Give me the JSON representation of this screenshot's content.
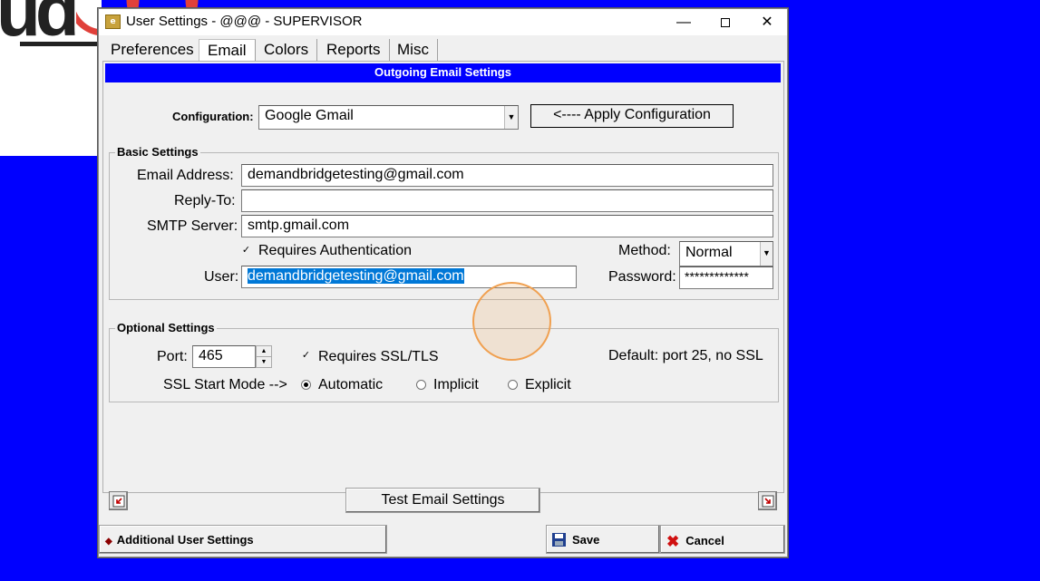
{
  "window": {
    "title": "User Settings - @@@ - SUPERVISOR",
    "app_icon_text": "e"
  },
  "tabs": [
    {
      "label": "Preferences",
      "active": false
    },
    {
      "label": "Email",
      "active": true
    },
    {
      "label": "Colors",
      "active": false
    },
    {
      "label": "Reports",
      "active": false
    },
    {
      "label": "Misc",
      "active": false
    }
  ],
  "header": {
    "title": "Outgoing Email Settings"
  },
  "configuration": {
    "label": "Configuration:",
    "value": "Google Gmail",
    "apply_label": "<---- Apply Configuration"
  },
  "basic": {
    "title": "Basic Settings",
    "email_label": "Email Address:",
    "email_value": "demandbridgetesting@gmail.com",
    "reply_label": "Reply-To:",
    "reply_value": "",
    "smtp_label": "SMTP Server:",
    "smtp_value": "smtp.gmail.com",
    "requires_auth_label": "Requires Authentication",
    "requires_auth_checked": true,
    "method_label": "Method:",
    "method_value": "Normal",
    "user_label": "User:",
    "user_value": "demandbridgetesting@gmail.com",
    "password_label": "Password:",
    "password_value": "*************"
  },
  "optional": {
    "title": "Optional Settings",
    "port_label": "Port:",
    "port_value": "465",
    "ssl_label": "Requires SSL/TLS",
    "ssl_checked": true,
    "default_note": "Default: port 25, no SSL",
    "ssl_mode_label": "SSL Start Mode -->",
    "mode_automatic": "Automatic",
    "mode_implicit": "Implicit",
    "mode_explicit": "Explicit",
    "mode_selected": "Automatic"
  },
  "test_button": "Test Email Settings",
  "bottom": {
    "additional_label": "Additional User Settings",
    "save_label": "Save",
    "cancel_label": "Cancel"
  },
  "colors": {
    "desktop": "#0000ff",
    "header_bar": "#0000ff",
    "selection": "#0078d7",
    "cursor_highlight": "#f0a050"
  }
}
